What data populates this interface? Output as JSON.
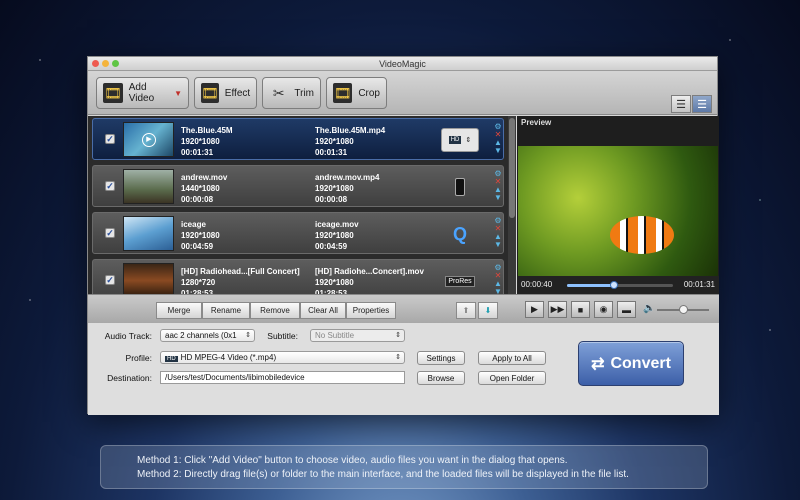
{
  "window": {
    "title": "VideoMagic"
  },
  "toolbar": {
    "add_video": "Add Video",
    "effect": "Effect",
    "trim": "Trim",
    "crop": "Crop"
  },
  "files": [
    {
      "name": "The.Blue.45M",
      "res": "1920*1080",
      "dur": "00:01:31",
      "out_name": "The.Blue.45M.mp4",
      "out_res": "1920*1080",
      "out_dur": "00:01:31",
      "selected": true,
      "device": "HD MPEG-4"
    },
    {
      "name": "andrew.mov",
      "res": "1440*1080",
      "dur": "00:00:08",
      "out_name": "andrew.mov.mp4",
      "out_res": "1920*1080",
      "out_dur": "00:00:08",
      "selected": false,
      "device": "iPhone"
    },
    {
      "name": "iceage",
      "res": "1920*1080",
      "dur": "00:04:59",
      "out_name": "iceage.mov",
      "out_res": "1920*1080",
      "out_dur": "00:04:59",
      "selected": false,
      "device": "QuickTime"
    },
    {
      "name": "[HD] Radiohead...[Full Concert]",
      "res": "1280*720",
      "dur": "01:28:53",
      "out_name": "[HD] Radiohe...Concert].mov",
      "out_res": "1920*1080",
      "out_dur": "01:28:53",
      "selected": false,
      "device": "ProRes"
    }
  ],
  "preview": {
    "label": "Preview",
    "time_current": "00:00:40",
    "time_total": "00:01:31",
    "progress": 0.44,
    "volume": 0.5
  },
  "edit_buttons": {
    "merge": "Merge",
    "rename": "Rename",
    "remove": "Remove",
    "clear_all": "Clear All",
    "properties": "Properties"
  },
  "settings": {
    "audio_track_label": "Audio Track:",
    "audio_track_value": "aac 2 channels (0x1",
    "subtitle_label": "Subtitle:",
    "subtitle_value": "No Subtitle",
    "profile_label": "Profile:",
    "profile_value": "HD MPEG-4 Video (*.mp4)",
    "settings_btn": "Settings",
    "apply_all_btn": "Apply to All",
    "destination_label": "Destination:",
    "destination_value": "/Users/test/Documents/libimobiledevice",
    "browse_btn": "Browse",
    "open_folder_btn": "Open Folder",
    "convert_btn": "Convert"
  },
  "help": {
    "line1": "Method 1: Click \"Add Video\" button to choose video, audio files you want in the dialog that opens.",
    "line2": "Method 2: Directly drag file(s) or folder to the main interface, and the loaded files will be displayed in the file list."
  }
}
